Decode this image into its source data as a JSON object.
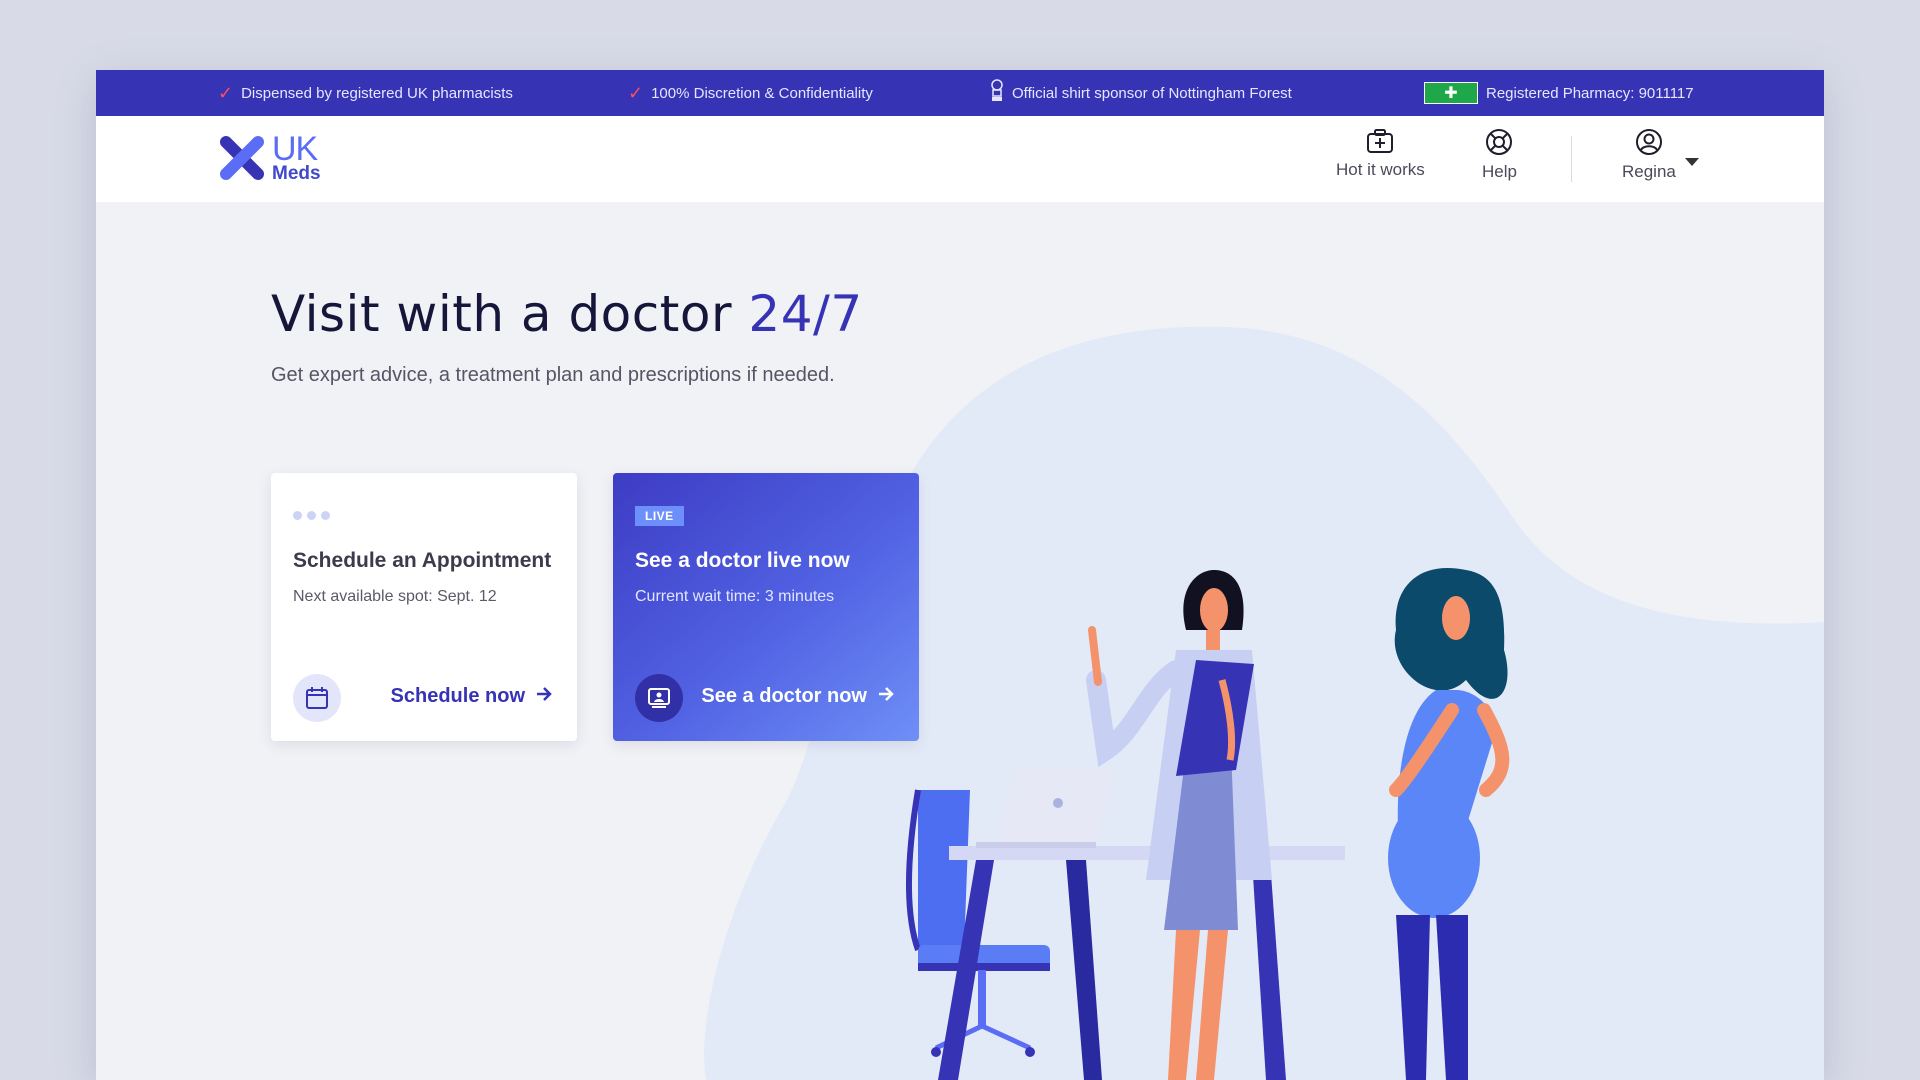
{
  "topbar": {
    "items": [
      {
        "icon": "check-icon",
        "text": "Dispensed by registered UK pharmacists"
      },
      {
        "icon": "check-icon",
        "text": "100% Discretion & Confidentiality"
      },
      {
        "icon": "trophy-icon",
        "text": "Official shirt sponsor of Nottingham Forest"
      },
      {
        "icon": "registered-pharmacy-badge",
        "text": "Registered Pharmacy: 9011117"
      }
    ]
  },
  "header": {
    "logo": {
      "uk": "UK",
      "meds": "Meds"
    },
    "nav": {
      "how_it_works": "Hot it works",
      "help": "Help",
      "user": "Regina"
    }
  },
  "hero": {
    "title_main": "Visit with a doctor ",
    "title_accent": "24/7",
    "subtitle": "Get expert advice, a treatment plan and prescriptions if needed."
  },
  "cards": {
    "schedule": {
      "title": "Schedule an Appointment",
      "meta": "Next available spot: Sept. 12",
      "cta": "Schedule now"
    },
    "live": {
      "badge": "LIVE",
      "title": "See a doctor live now",
      "meta": "Current wait time: 3 minutes",
      "cta": "See a doctor now"
    }
  },
  "colors": {
    "brand": "#3633b5",
    "accent_light": "#6d8ffa",
    "page_bg": "#f1f2f6",
    "blob": "#e3eaf7"
  }
}
